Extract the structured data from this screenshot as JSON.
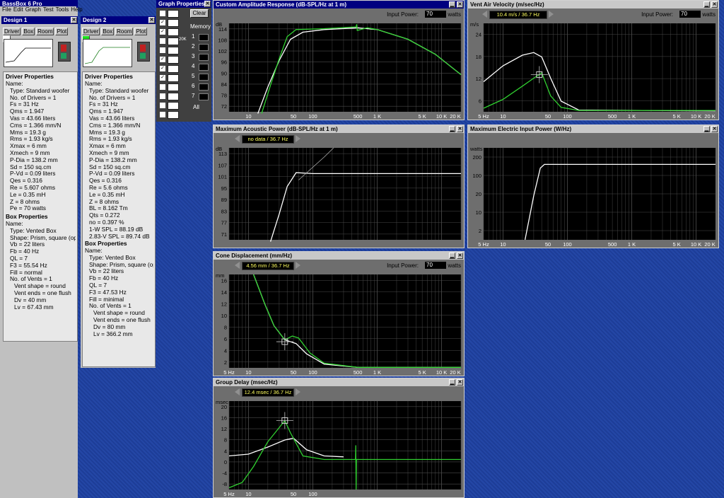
{
  "app": {
    "title": "BassBox 6 Pro",
    "menu": [
      "File",
      "Edit",
      "Graph",
      "Test",
      "Tools",
      "Help"
    ],
    "colors": {
      "titlebar_active": "#000080",
      "desktop": "#1f3f9a",
      "plot_bg": "#000000",
      "curve_design1": "#ffffff",
      "curve_design2": "#30d030"
    }
  },
  "design1": {
    "title": "Design 1",
    "tabs": [
      "Driver",
      "Box",
      "Room",
      "Plot"
    ],
    "driver_heading": "Driver Properties",
    "driver_lines": [
      "Name:",
      "Type: Standard woofer",
      "No. of Drivers = 1",
      "Fs = 31 Hz",
      "Qms = 1.947",
      "Vas = 43.66 liters",
      "Cms = 1.366 mm/N",
      "Mms = 19.3 g",
      "Rms = 1.93 kg/s",
      "Xmax = 6 mm",
      "Xmech = 9 mm",
      "P-Dia = 138.2 mm",
      "Sd = 150 sq.cm",
      "P-Vd = 0.09 liters",
      "Qes = 0.316",
      "Re = 5.607 ohms",
      "Le = 0.35 mH",
      "Z = 8 ohms",
      "Pe = 70 watts"
    ],
    "box_heading": "Box Properties",
    "box_lines": [
      "Name:",
      "Type: Vented Box",
      "Shape: Prism, square (optim",
      "Vb = 22 liters",
      "Fb = 40 Hz",
      "QL = 7",
      "F3 = 55.54 Hz",
      "Fill = normal",
      "No. of Vents = 1",
      "Vent shape = round",
      "Vent ends = one flush",
      "Dv = 40 mm",
      "Lv = 67.43 mm"
    ]
  },
  "design2": {
    "title": "Design 2",
    "tabs": [
      "Driver",
      "Box",
      "Room",
      "Plot"
    ],
    "driver_heading": "Driver Properties",
    "driver_lines": [
      "Name:",
      "Type: Standard woofer",
      "No. of Drivers = 1",
      "Fs = 31 Hz",
      "Qms = 1.947",
      "Vas = 43.66 liters",
      "Cms = 1.366 mm/N",
      "Mms = 19.3 g",
      "Rms = 1.93 kg/s",
      "Xmax = 6 mm",
      "Xmech = 9 mm",
      "P-Dia = 138.2 mm",
      "Sd = 150 sq.cm",
      "P-Vd = 0.09 liters",
      "Qes = 0.316",
      "Re = 5.6 ohms",
      "Le = 0.35 mH",
      "Z = 8 ohms",
      "BL = 8.162 Tm",
      "Qts = 0.272",
      "no = 0.397 %",
      "1-W SPL = 88.19 dB",
      "2.83-V SPL = 89.74 dB"
    ],
    "box_heading": "Box Properties",
    "box_lines": [
      "Name:",
      "Type: Vented Box",
      "Shape: Prism, square (optim",
      "Vb = 22 liters",
      "Fb = 40 Hz",
      "QL = 7",
      "F3 = 47.53 Hz",
      "Fill = minimal",
      "No. of Vents = 1",
      "Vent shape = round",
      "Vent ends = one flush",
      "Dv = 80 mm",
      "Lv = 366.2 mm"
    ]
  },
  "graph_props": {
    "title": "Graph Properties",
    "clear_label": "Clear",
    "memory_label": "Memory",
    "memory_slots": [
      "1",
      "2",
      "3",
      "4",
      "5",
      "6",
      "7"
    ],
    "all_label": "All",
    "icon_20k": "20K"
  },
  "graphs": {
    "amplitude": {
      "title": "Custom Amplitude Response (dB-SPL/Hz at 1 m)",
      "input_label": "Input Power:",
      "input_value": "70",
      "units": "watts",
      "y_unit": "dB",
      "yticks": [
        "114",
        "108",
        "102",
        "96",
        "90",
        "84",
        "78",
        "72"
      ],
      "xticks": [
        "10",
        "50",
        "100",
        "500",
        "1 K",
        "5 K",
        "10 K",
        "20 K"
      ]
    },
    "velocity": {
      "title": "Vent Air Velocity (m/sec/Hz)",
      "readout": "10.4 m/s / 36.7 Hz",
      "input_label": "Input Power:",
      "input_value": "70",
      "units": "watts",
      "y_unit": "m/s",
      "yticks": [
        "24",
        "18",
        "12",
        "6"
      ],
      "xticks": [
        "5 Hz",
        "10",
        "50",
        "100",
        "500",
        "1 K",
        "5 K",
        "10 K",
        "20 K"
      ]
    },
    "acoustic": {
      "title": "Maximum Acoustic Power (dB-SPL/Hz at 1 m)",
      "readout": "no data / 36.7 Hz",
      "y_unit": "dB",
      "yticks": [
        "113",
        "107",
        "101",
        "95",
        "89",
        "83",
        "77",
        "71"
      ],
      "xticks": []
    },
    "electric": {
      "title": "Maximum Electric Input Power (W/Hz)",
      "y_unit": "watts",
      "yticks": [
        "200",
        "100",
        "20",
        "10",
        "2"
      ],
      "xticks": [
        "5 Hz",
        "10",
        "50",
        "100",
        "500",
        "1 K",
        "5 K",
        "10 K",
        "20 K"
      ]
    },
    "cone": {
      "title": "Cone Displacement (mm/Hz)",
      "readout": "4.56 mm / 36.7 Hz",
      "input_label": "Input Power:",
      "input_value": "70",
      "units": "watts",
      "y_unit": "mm",
      "yticks": [
        "16",
        "14",
        "12",
        "10",
        "8",
        "6",
        "4",
        "2"
      ],
      "xticks": [
        "5 Hz",
        "10",
        "50",
        "100",
        "500",
        "1 K",
        "5 K",
        "10 K",
        "20 K"
      ]
    },
    "delay": {
      "title": "Group Delay (msec/Hz)",
      "readout": "12.4 msec / 36.7 Hz",
      "y_unit": "msec",
      "yticks": [
        "20",
        "16",
        "12",
        "8",
        "4",
        "0",
        "-4",
        "-8"
      ],
      "xticks": [
        "5 Hz",
        "10",
        "50",
        "100"
      ]
    }
  }
}
